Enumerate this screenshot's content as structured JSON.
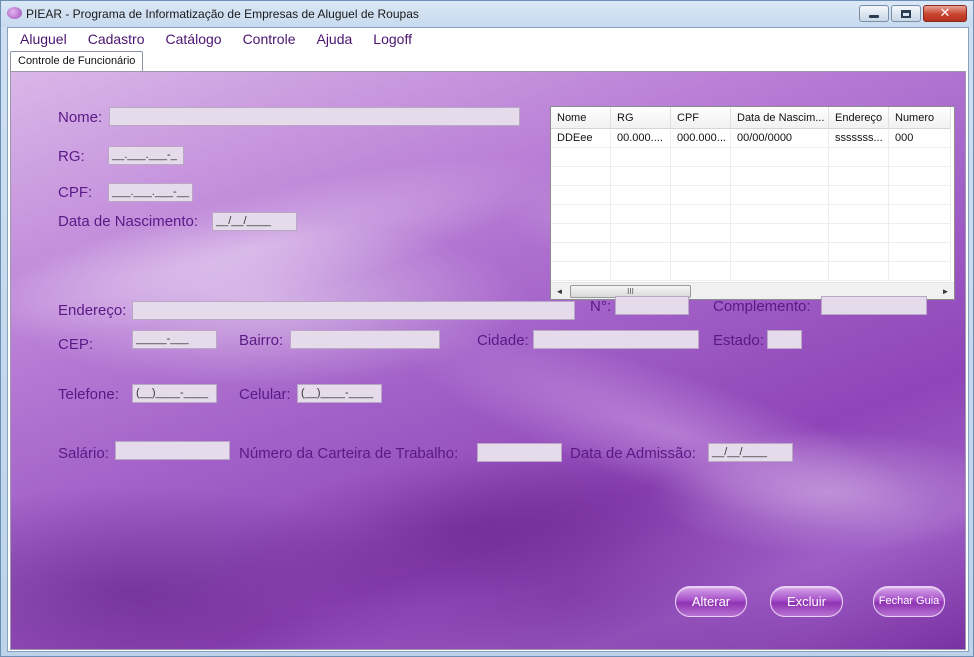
{
  "window": {
    "title": "PIEAR - Programa de Informatização de Empresas de Aluguel de Roupas",
    "accent": "#5a1a86"
  },
  "menu": [
    "Aluguel",
    "Cadastro",
    "Catálogo",
    "Controle",
    "Ajuda",
    "Logoff"
  ],
  "tab": {
    "label": "Controle de Funcionário"
  },
  "form": {
    "nome": {
      "label": "Nome:",
      "value": ""
    },
    "rg": {
      "label": "RG:",
      "value": "__.___.___-_"
    },
    "cpf": {
      "label": "CPF:",
      "value": "___.___.___-__"
    },
    "nascimento": {
      "label": "Data de Nascimento:",
      "value": "__/__/____"
    },
    "endereco": {
      "label": "Endereço:",
      "value": ""
    },
    "numero": {
      "label": "N°:",
      "value": ""
    },
    "complemento": {
      "label": "Complemento:",
      "value": ""
    },
    "cep": {
      "label": "CEP:",
      "value": "_____-___"
    },
    "bairro": {
      "label": "Bairro:",
      "value": ""
    },
    "cidade": {
      "label": "Cidade:",
      "value": ""
    },
    "estado": {
      "label": "Estado:",
      "value": ""
    },
    "telefone": {
      "label": "Telefone:",
      "value": "(__)____-____"
    },
    "celular": {
      "label": "Celular:",
      "value": "(__)____-____"
    },
    "salario": {
      "label": "Salário:",
      "value": ""
    },
    "carteira": {
      "label": "Número da Carteira de Trabalho:",
      "value": ""
    },
    "admissao": {
      "label": "Data de Admissão:",
      "value": "__/__/____"
    }
  },
  "grid": {
    "columns": [
      "Nome",
      "RG",
      "CPF",
      "Data de Nascim...",
      "Endereço",
      "Numero"
    ],
    "rows": [
      [
        "DDEee",
        "00.000....",
        "000.000...",
        "00/00/0000",
        "sssssss...",
        "000"
      ]
    ],
    "scroll_left": "◄",
    "scroll_right": "►",
    "scroll_grip": "III"
  },
  "buttons": {
    "alterar": "Alterar",
    "excluir": "Excluir",
    "fechar": "Fechar Guia"
  }
}
